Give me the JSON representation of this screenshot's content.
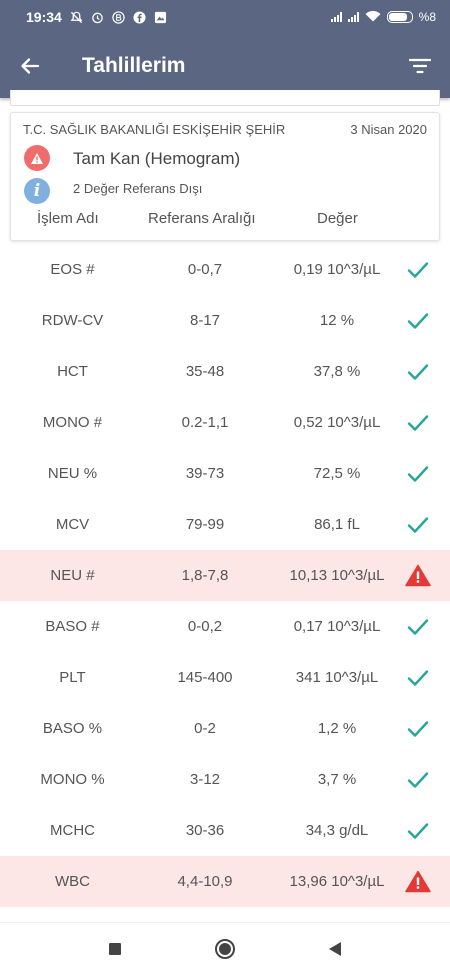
{
  "status_bar": {
    "time": "19:34",
    "battery": "%8",
    "icons": [
      "mute-icon",
      "alarm-icon",
      "b-app-icon",
      "facebook-icon",
      "gallery-icon",
      "signal-icon",
      "signal-icon",
      "wifi-icon",
      "battery-icon"
    ]
  },
  "app_bar": {
    "title": "Tahlillerim"
  },
  "card": {
    "institution": "T.C. SAĞLIK BAKANLIĞI ESKİŞEHİR ŞEHİR",
    "date": "3 Nisan 2020",
    "test_name": "Tam Kan (Hemogram)",
    "ref_note": "2 Değer Referans Dışı",
    "col_name": "İşlem Adı",
    "col_ref": "Referans Aralığı",
    "col_value": "Değer"
  },
  "rows": [
    {
      "name": "EOS #",
      "ref": "0-0,7",
      "value": "0,19 10^3/µL",
      "status": "ok"
    },
    {
      "name": "RDW-CV",
      "ref": "8-17",
      "value": "12 %",
      "status": "ok"
    },
    {
      "name": "HCT",
      "ref": "35-48",
      "value": "37,8 %",
      "status": "ok"
    },
    {
      "name": "MONO #",
      "ref": "0.2-1,1",
      "value": "0,52 10^3/µL",
      "status": "ok"
    },
    {
      "name": "NEU %",
      "ref": "39-73",
      "value": "72,5 %",
      "status": "ok"
    },
    {
      "name": "MCV",
      "ref": "79-99",
      "value": "86,1 fL",
      "status": "ok"
    },
    {
      "name": "NEU #",
      "ref": "1,8-7,8",
      "value": "10,13 10^3/µL",
      "status": "warning"
    },
    {
      "name": "BASO #",
      "ref": "0-0,2",
      "value": "0,17 10^3/µL",
      "status": "ok"
    },
    {
      "name": "PLT",
      "ref": "145-400",
      "value": "341 10^3/µL",
      "status": "ok"
    },
    {
      "name": "BASO %",
      "ref": "0-2",
      "value": "1,2 %",
      "status": "ok"
    },
    {
      "name": "MONO %",
      "ref": "3-12",
      "value": "3,7 %",
      "status": "ok"
    },
    {
      "name": "MCHC",
      "ref": "30-36",
      "value": "34,3 g/dL",
      "status": "ok"
    },
    {
      "name": "WBC",
      "ref": "4,4-10,9",
      "value": "13,96 10^3/µL",
      "status": "warning"
    }
  ],
  "colors": {
    "app_bar": "#5b6782",
    "ok_check": "#26a69a",
    "warning": "#e53935",
    "flag_row_bg": "#fde6e6",
    "info_icon": "#7fb0e0"
  }
}
